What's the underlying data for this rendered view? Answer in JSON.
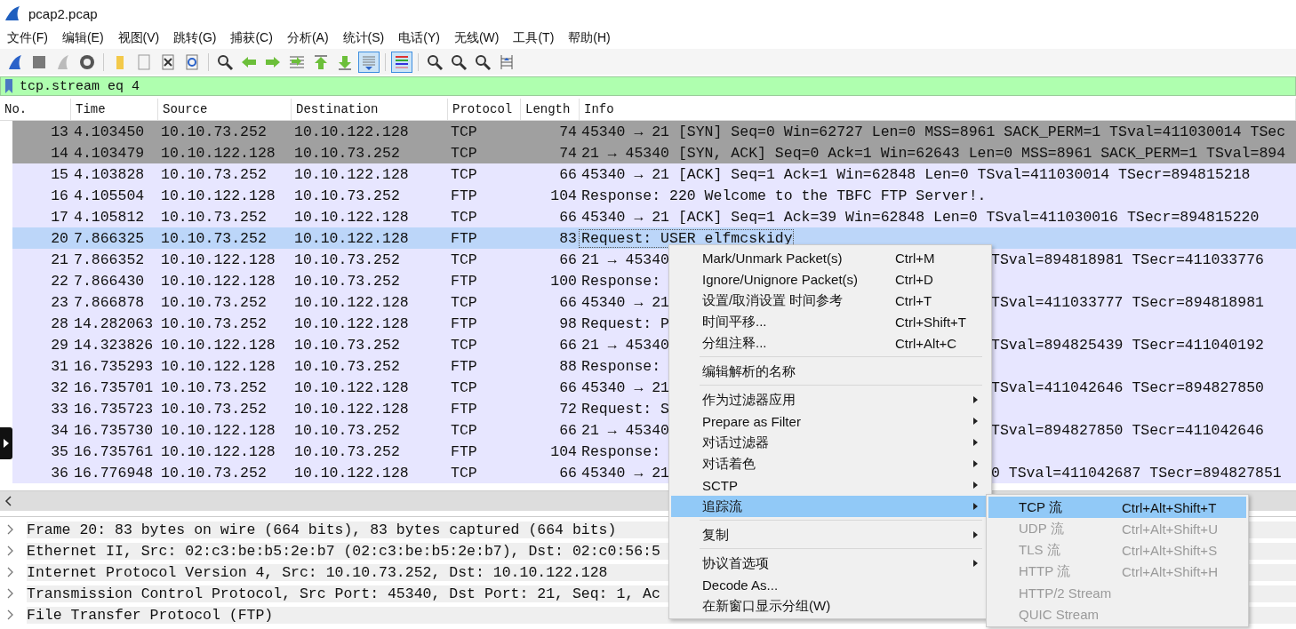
{
  "window": {
    "title": "pcap2.pcap"
  },
  "menubar": [
    "文件(F)",
    "编辑(E)",
    "视图(V)",
    "跳转(G)",
    "捕获(C)",
    "分析(A)",
    "统计(S)",
    "电话(Y)",
    "无线(W)",
    "工具(T)",
    "帮助(H)"
  ],
  "toolbar": [
    {
      "kind": "fin",
      "on": false
    },
    {
      "kind": "stop",
      "on": false
    },
    {
      "kind": "restart",
      "on": false
    },
    {
      "kind": "options",
      "on": false
    },
    {
      "kind": "sep"
    },
    {
      "kind": "open",
      "on": false
    },
    {
      "kind": "file",
      "on": false
    },
    {
      "kind": "close",
      "on": false
    },
    {
      "kind": "reload",
      "on": false
    },
    {
      "kind": "sep"
    },
    {
      "kind": "find",
      "on": false
    },
    {
      "kind": "back",
      "on": false
    },
    {
      "kind": "forward",
      "on": false
    },
    {
      "kind": "goto",
      "on": false
    },
    {
      "kind": "first",
      "on": false
    },
    {
      "kind": "last",
      "on": false
    },
    {
      "kind": "autoscroll",
      "on": true
    },
    {
      "kind": "sep"
    },
    {
      "kind": "colorize",
      "on": true
    },
    {
      "kind": "sep"
    },
    {
      "kind": "zoomin",
      "on": false
    },
    {
      "kind": "zoomout",
      "on": false
    },
    {
      "kind": "zoomreset",
      "on": false
    },
    {
      "kind": "resize",
      "on": false
    }
  ],
  "filter": {
    "value": "tcp.stream eq 4"
  },
  "columns": [
    "No.",
    "Time",
    "Source",
    "Destination",
    "Protocol",
    "Length",
    "Info"
  ],
  "rows": [
    {
      "no": "13",
      "time": "4.103450",
      "source": "10.10.73.252",
      "destination": "10.10.122.128",
      "protocol": "TCP",
      "length": "74",
      "info": "45340 → 21 [SYN] Seq=0 Win=62727 Len=0 MSS=8961 SACK_PERM=1 TSval=411030014 TSec",
      "color": "#a0a0a0",
      "selected": false
    },
    {
      "no": "14",
      "time": "4.103479",
      "source": "10.10.122.128",
      "destination": "10.10.73.252",
      "protocol": "TCP",
      "length": "74",
      "info": "21 → 45340 [SYN, ACK] Seq=0 Ack=1 Win=62643 Len=0 MSS=8961 SACK_PERM=1 TSval=894",
      "color": "#a0a0a0",
      "selected": false
    },
    {
      "no": "15",
      "time": "4.103828",
      "source": "10.10.73.252",
      "destination": "10.10.122.128",
      "protocol": "TCP",
      "length": "66",
      "info": "45340 → 21 [ACK] Seq=1 Ack=1 Win=62848 Len=0 TSval=411030014 TSecr=894815218",
      "color": "#e7e6ff",
      "selected": false
    },
    {
      "no": "16",
      "time": "4.105504",
      "source": "10.10.122.128",
      "destination": "10.10.73.252",
      "protocol": "FTP",
      "length": "104",
      "info": "Response: 220 Welcome to the TBFC FTP Server!.",
      "color": "#e7e6ff",
      "selected": false
    },
    {
      "no": "17",
      "time": "4.105812",
      "source": "10.10.73.252",
      "destination": "10.10.122.128",
      "protocol": "TCP",
      "length": "66",
      "info": "45340 → 21 [ACK] Seq=1 Ack=39 Win=62848 Len=0 TSval=411030016 TSecr=894815220",
      "color": "#e7e6ff",
      "selected": false
    },
    {
      "no": "20",
      "time": "7.866325",
      "source": "10.10.73.252",
      "destination": "10.10.122.128",
      "protocol": "FTP",
      "length": "83",
      "info": "Request: USER elfmcskidy",
      "selected": true
    },
    {
      "no": "21",
      "time": "7.866352",
      "source": "10.10.122.128",
      "destination": "10.10.73.252",
      "protocol": "TCP",
      "length": "66",
      "info": "21 → 45340",
      "info_tail": "TSval=894818981 TSecr=411033776",
      "color": "#e7e6ff",
      "selected": false
    },
    {
      "no": "22",
      "time": "7.866430",
      "source": "10.10.122.128",
      "destination": "10.10.73.252",
      "protocol": "FTP",
      "length": "100",
      "info": "Response:",
      "color": "#e7e6ff",
      "selected": false
    },
    {
      "no": "23",
      "time": "7.866878",
      "source": "10.10.73.252",
      "destination": "10.10.122.128",
      "protocol": "TCP",
      "length": "66",
      "info": "45340 → 21",
      "info_tail": "TSval=411033777 TSecr=894818981",
      "color": "#e7e6ff",
      "selected": false
    },
    {
      "no": "28",
      "time": "14.282063",
      "source": "10.10.73.252",
      "destination": "10.10.122.128",
      "protocol": "FTP",
      "length": "98",
      "info": "Request: P",
      "color": "#e7e6ff",
      "selected": false
    },
    {
      "no": "29",
      "time": "14.323826",
      "source": "10.10.122.128",
      "destination": "10.10.73.252",
      "protocol": "TCP",
      "length": "66",
      "info": "21 → 45340",
      "info_tail": "TSval=894825439 TSecr=411040192",
      "color": "#e7e6ff",
      "selected": false
    },
    {
      "no": "31",
      "time": "16.735293",
      "source": "10.10.122.128",
      "destination": "10.10.73.252",
      "protocol": "FTP",
      "length": "88",
      "info": "Response:",
      "color": "#e7e6ff",
      "selected": false
    },
    {
      "no": "32",
      "time": "16.735701",
      "source": "10.10.73.252",
      "destination": "10.10.122.128",
      "protocol": "TCP",
      "length": "66",
      "info": "45340 → 21",
      "info_tail": "TSval=411042646 TSecr=894827850",
      "color": "#e7e6ff",
      "selected": false
    },
    {
      "no": "33",
      "time": "16.735723",
      "source": "10.10.73.252",
      "destination": "10.10.122.128",
      "protocol": "FTP",
      "length": "72",
      "info": "Request: S",
      "color": "#e7e6ff",
      "selected": false
    },
    {
      "no": "34",
      "time": "16.735730",
      "source": "10.10.122.128",
      "destination": "10.10.73.252",
      "protocol": "TCP",
      "length": "66",
      "info": "21 → 45340",
      "info_tail": "TSval=894827850 TSecr=411042646",
      "color": "#e7e6ff",
      "selected": false
    },
    {
      "no": "35",
      "time": "16.735761",
      "source": "10.10.122.128",
      "destination": "10.10.73.252",
      "protocol": "FTP",
      "length": "104",
      "info": "Response:",
      "color": "#e7e6ff",
      "selected": false
    },
    {
      "no": "36",
      "time": "16.776948",
      "source": "10.10.73.252",
      "destination": "10.10.122.128",
      "protocol": "TCP",
      "length": "66",
      "info": "45340 → 21",
      "info_tail": "0 TSval=411042687 TSecr=894827851",
      "color": "#e7e6ff",
      "selected": false
    }
  ],
  "details": [
    {
      "text": "Frame 20: 83 bytes on wire (664 bits), 83 bytes captured (664 bits)",
      "expanded": false
    },
    {
      "text": "Ethernet II, Src: 02:c3:be:b5:2e:b7 (02:c3:be:b5:2e:b7), Dst: 02:c0:56:5",
      "expanded": false
    },
    {
      "text": "Internet Protocol Version 4, Src: 10.10.73.252, Dst: 10.10.122.128",
      "expanded": false
    },
    {
      "text": "Transmission Control Protocol, Src Port: 45340, Dst Port: 21, Seq: 1, Ac",
      "expanded": false
    },
    {
      "text": "File Transfer Protocol (FTP)",
      "expanded": false
    }
  ],
  "context_menu": {
    "items": [
      {
        "kind": "item",
        "label": "Mark/Unmark Packet(s)",
        "shortcut": "Ctrl+M",
        "submenu": false,
        "selected": false
      },
      {
        "kind": "item",
        "label": "Ignore/Unignore Packet(s)",
        "shortcut": "Ctrl+D",
        "submenu": false,
        "selected": false
      },
      {
        "kind": "item",
        "label": "设置/取消设置 时间参考",
        "shortcut": "Ctrl+T",
        "submenu": false,
        "selected": false
      },
      {
        "kind": "item",
        "label": "时间平移...",
        "shortcut": "Ctrl+Shift+T",
        "submenu": false,
        "selected": false
      },
      {
        "kind": "item",
        "label": "分组注释...",
        "shortcut": "Ctrl+Alt+C",
        "submenu": false,
        "selected": false
      },
      {
        "kind": "separator"
      },
      {
        "kind": "item",
        "label": "编辑解析的名称",
        "submenu": false,
        "selected": false
      },
      {
        "kind": "separator"
      },
      {
        "kind": "item",
        "label": "作为过滤器应用",
        "submenu": true,
        "selected": false
      },
      {
        "kind": "item",
        "label": "Prepare as Filter",
        "submenu": true,
        "selected": false
      },
      {
        "kind": "item",
        "label": "对话过滤器",
        "submenu": true,
        "selected": false
      },
      {
        "kind": "item",
        "label": "对话着色",
        "submenu": true,
        "selected": false
      },
      {
        "kind": "item",
        "label": "SCTP",
        "submenu": true,
        "selected": false
      },
      {
        "kind": "item",
        "label": "追踪流",
        "submenu": true,
        "selected": true
      },
      {
        "kind": "separator"
      },
      {
        "kind": "item",
        "label": "复制",
        "submenu": true,
        "selected": false
      },
      {
        "kind": "separator"
      },
      {
        "kind": "item",
        "label": "协议首选项",
        "submenu": true,
        "selected": false
      },
      {
        "kind": "item",
        "label": "Decode As...",
        "submenu": false,
        "selected": false
      },
      {
        "kind": "item",
        "label": "在新窗口显示分组(W)",
        "submenu": false,
        "selected": false
      }
    ],
    "submenu": [
      {
        "label": "TCP 流",
        "shortcut": "Ctrl+Alt+Shift+T",
        "disabled": false,
        "selected": true
      },
      {
        "label": "UDP 流",
        "shortcut": "Ctrl+Alt+Shift+U",
        "disabled": true,
        "selected": false
      },
      {
        "label": "TLS 流",
        "shortcut": "Ctrl+Alt+Shift+S",
        "disabled": true,
        "selected": false
      },
      {
        "label": "HTTP 流",
        "shortcut": "Ctrl+Alt+Shift+H",
        "disabled": true,
        "selected": false
      },
      {
        "label": "HTTP/2 Stream",
        "disabled": true,
        "selected": false
      },
      {
        "label": "QUIC Stream",
        "disabled": true,
        "selected": false
      }
    ]
  }
}
